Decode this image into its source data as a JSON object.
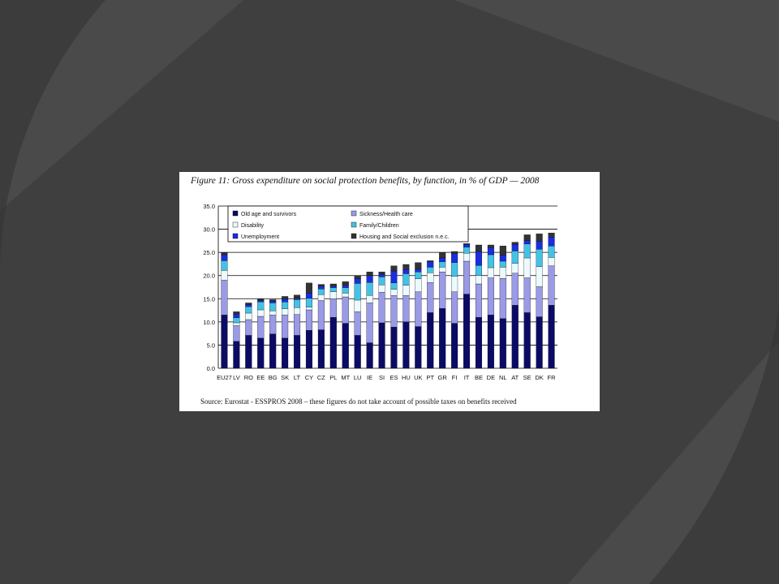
{
  "slide": {
    "background": "#3f3f3f",
    "stripe_color": "#4a4a4a",
    "stripe_dark": "#343434"
  },
  "figure": {
    "title": "Figure 11: Gross expenditure on social protection benefits, by function, in % of GDP — 2008",
    "source": "Source: Eurostat - ESSPROS 2008 – these figures do not take account of possible taxes on benefits received"
  },
  "chart_data": {
    "type": "bar",
    "stacked": true,
    "title": "Figure 11: Gross expenditure on social protection benefits, by function, in % of GDP — 2008",
    "xlabel": "",
    "ylabel": "",
    "ylim": [
      0,
      35
    ],
    "yticks": [
      "0.0",
      "5.0",
      "10.0",
      "15.0",
      "20.0",
      "25.0",
      "30.0",
      "35.0"
    ],
    "grid": true,
    "legend_position": "top-left",
    "categories": [
      "EU27",
      "LV",
      "RO",
      "EE",
      "BG",
      "SK",
      "LT",
      "CY",
      "CZ",
      "PL",
      "MT",
      "LU",
      "IE",
      "SI",
      "ES",
      "HU",
      "UK",
      "PT",
      "GR",
      "FI",
      "IT",
      "BE",
      "DE",
      "NL",
      "AT",
      "SE",
      "DK",
      "FR"
    ],
    "series": [
      {
        "name": "Old age and survivors",
        "color": "#0b0b66",
        "values": [
          11.5,
          5.8,
          7.1,
          6.5,
          7.4,
          6.5,
          7.1,
          8.2,
          8.3,
          11.0,
          9.7,
          7.1,
          5.5,
          9.8,
          8.9,
          10.0,
          9.0,
          12.0,
          12.9,
          9.7,
          16.0,
          11.0,
          11.5,
          10.7,
          13.6,
          12.0,
          11.1,
          13.6
        ]
      },
      {
        "name": "Sickness/Health care",
        "color": "#9a9ae6",
        "values": [
          7.5,
          3.4,
          3.4,
          4.7,
          4.1,
          5.0,
          4.5,
          4.4,
          6.3,
          4.0,
          5.7,
          5.1,
          8.6,
          6.6,
          6.8,
          5.7,
          7.5,
          6.5,
          7.9,
          6.8,
          7.1,
          7.2,
          8.0,
          8.7,
          6.9,
          7.5,
          6.5,
          8.5
        ]
      },
      {
        "name": "Disability",
        "color": "#ecfaff",
        "values": [
          2.1,
          0.6,
          1.4,
          1.4,
          0.9,
          1.3,
          1.5,
          0.6,
          1.3,
          1.5,
          0.8,
          2.5,
          1.6,
          1.6,
          1.3,
          2.2,
          2.8,
          2.1,
          1.0,
          3.3,
          1.7,
          1.8,
          2.2,
          2.4,
          2.1,
          4.3,
          4.3,
          1.8
        ]
      },
      {
        "name": "Family/Children",
        "color": "#44c2e6",
        "values": [
          2.1,
          1.1,
          1.4,
          1.7,
          1.7,
          1.5,
          1.7,
          1.9,
          1.2,
          0.9,
          1.2,
          3.6,
          2.8,
          1.7,
          1.4,
          2.5,
          1.5,
          1.2,
          1.2,
          3.0,
          1.3,
          2.2,
          2.8,
          1.3,
          2.7,
          3.0,
          3.8,
          2.5
        ]
      },
      {
        "name": "Unemployment",
        "color": "#1a2ee0",
        "values": [
          1.3,
          0.8,
          0.4,
          0.3,
          0.4,
          0.6,
          0.3,
          1.1,
          0.6,
          0.3,
          0.5,
          1.0,
          1.5,
          0.6,
          2.6,
          0.9,
          0.6,
          1.2,
          0.8,
          1.9,
          0.6,
          3.0,
          1.5,
          1.3,
          1.4,
          0.7,
          1.7,
          1.9
        ]
      },
      {
        "name": "Housing and Social exclusion n.e.c.",
        "color": "#333333",
        "values": [
          0.5,
          0.5,
          0.4,
          0.3,
          0.3,
          0.6,
          0.7,
          2.2,
          0.4,
          0.5,
          0.8,
          0.7,
          0.8,
          0.5,
          1.1,
          1.1,
          1.4,
          0.2,
          1.2,
          0.5,
          0.2,
          1.4,
          0.6,
          2.0,
          0.5,
          1.3,
          1.6,
          0.9
        ]
      }
    ]
  }
}
